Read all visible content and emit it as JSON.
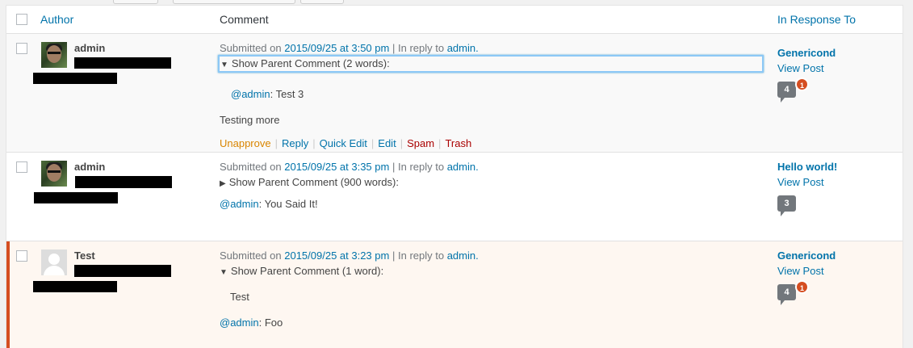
{
  "columns": {
    "author": "Author",
    "comment": "Comment",
    "response": "In Response To"
  },
  "submitted_prefix": "Submitted on",
  "in_reply_prefix": "In reply to",
  "separator": "|",
  "rows": [
    {
      "author": "admin",
      "submitted_date": "2015/09/25 at 3:50 pm",
      "reply_to": "admin.",
      "parent_toggle": "Show Parent Comment (2 words):",
      "parent_expanded": true,
      "parent_mention": "@admin",
      "parent_text": ": Test 3",
      "body": "Testing more",
      "actions": {
        "unapprove": "Unapprove",
        "reply": "Reply",
        "quick_edit": "Quick Edit",
        "edit": "Edit",
        "spam": "Spam",
        "trash": "Trash"
      },
      "post_title": "Genericond",
      "view_post": "View Post",
      "comment_count": "4",
      "pending_count": "1"
    },
    {
      "author": "admin",
      "submitted_date": "2015/09/25 at 3:35 pm",
      "reply_to": "admin.",
      "parent_toggle": "Show Parent Comment (900 words):",
      "parent_expanded": false,
      "body_mention": "@admin",
      "body_text": ": You Said It!",
      "post_title": "Hello world!",
      "view_post": "View Post",
      "comment_count": "3"
    },
    {
      "author": "Test",
      "submitted_date": "2015/09/25 at 3:23 pm",
      "reply_to": "admin.",
      "parent_toggle": "Show Parent Comment (1 word):",
      "parent_expanded": true,
      "parent_text": "Test",
      "body_mention": "@admin",
      "body_text": ": Foo",
      "post_title": "Genericond",
      "view_post": "View Post",
      "comment_count": "4",
      "pending_count": "1"
    }
  ],
  "colors": {
    "link": "#0073aa",
    "pending_border": "#d54e21",
    "unapprove": "#d98500",
    "danger": "#a00"
  }
}
